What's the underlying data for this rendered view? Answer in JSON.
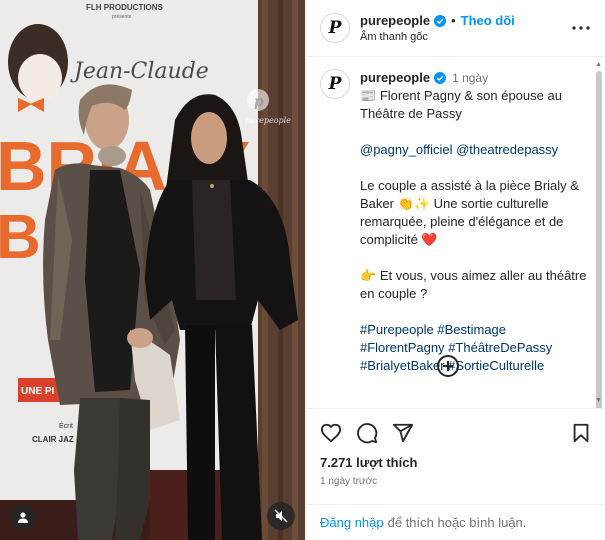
{
  "header": {
    "avatar_letter": "P",
    "username": "purepeople",
    "separator": "•",
    "follow_label": "Theo dõi",
    "audio_label": "Âm thanh gốc",
    "more_icon": "more-horizontal-icon"
  },
  "caption": {
    "avatar_letter": "P",
    "username": "purepeople",
    "time": "1 ngày",
    "line1_emoji": "📰",
    "line1_text": "Florent Pagny & son épouse au Théâtre de Passy",
    "mention1": "@pagny_officiel",
    "mention2": "@theatredepassy",
    "para2_a": "Le couple a assisté à la pièce Brialy & Baker",
    "para2_emoji": "👏✨",
    "para2_b": "Une sortie culturelle remarquée, pleine d'élégance et de complicité",
    "para2_emoji2": "❤️",
    "para3_emoji": "👉",
    "para3_text": "Et vous, vous aimez aller au théâtre en couple ?",
    "hashtags": [
      "#Purepeople",
      "#Bestimage",
      "#FlorentPagny",
      "#ThéâtreDePassy",
      "#BrialyetBaker",
      "#SortieCulturelle"
    ]
  },
  "poster": {
    "producer": "FLH PRODUCTIONS",
    "presents": "présente",
    "firstname": "Jean-Claude",
    "title_letters": "BRIALY",
    "title_letters2": "BAKER",
    "bottom_text": "UNE PI",
    "author_label": "Écrit",
    "author_name": "CLAIR JAZ",
    "watermark": "purepeople"
  },
  "actions": {
    "like_icon": "heart-icon",
    "comment_icon": "comment-icon",
    "share_icon": "send-icon",
    "save_icon": "bookmark-icon",
    "likes_text": "7.271 lượt thích",
    "posted_text": "1 ngày trước"
  },
  "login": {
    "link": "Đăng nhập",
    "rest": "để thích hoặc bình luận."
  },
  "colors": {
    "accent": "#0095f6",
    "link": "#00376b",
    "muted": "#737373"
  }
}
